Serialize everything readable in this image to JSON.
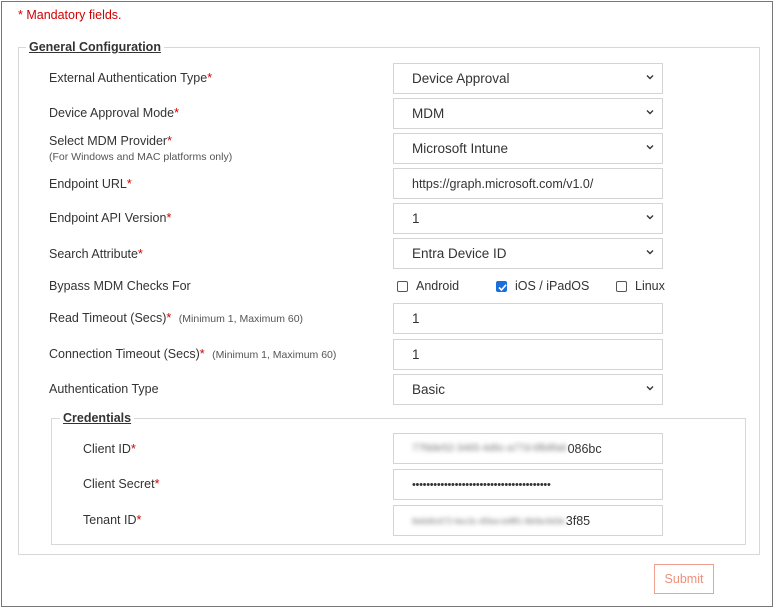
{
  "mandatory_note": "* Mandatory fields.",
  "general": {
    "legend": "General Configuration",
    "ext_auth_type": {
      "label": "External Authentication Type",
      "req": "*",
      "value": "Device Approval"
    },
    "device_approval_mode": {
      "label": "Device Approval Mode",
      "req": "*",
      "value": "MDM"
    },
    "mdm_provider": {
      "label": "Select MDM Provider",
      "req": "*",
      "hint": "(For Windows and MAC platforms only)",
      "value": "Microsoft Intune"
    },
    "endpoint_url": {
      "label": "Endpoint URL",
      "req": "*",
      "value": "https://graph.microsoft.com/v1.0/"
    },
    "endpoint_api_version": {
      "label": "Endpoint API Version",
      "req": "*",
      "value": "1"
    },
    "search_attribute": {
      "label": "Search Attribute",
      "req": "*",
      "value": "Entra Device ID"
    },
    "bypass": {
      "label": "Bypass MDM Checks For",
      "options": [
        {
          "label": "Android",
          "checked": false
        },
        {
          "label": "iOS / iPadOS",
          "checked": true
        },
        {
          "label": "Linux",
          "checked": false
        }
      ]
    },
    "read_timeout": {
      "label": "Read Timeout (Secs)",
      "req": "*",
      "hint": "(Minimum 1, Maximum 60)",
      "value": "1"
    },
    "connection_timeout": {
      "label": "Connection Timeout (Secs)",
      "req": "*",
      "hint": "(Minimum 1, Maximum 60)",
      "value": "1"
    },
    "auth_type": {
      "label": "Authentication Type",
      "value": "Basic"
    }
  },
  "credentials": {
    "legend": "Credentials",
    "client_id": {
      "label": "Client ID",
      "req": "*",
      "value_blurred": "77fdde52-3465-4d6c-a77d-6fb8fa6",
      "value_visible": "086bc"
    },
    "client_secret": {
      "label": "Client Secret",
      "req": "*",
      "value": "•••••••••••••••••••••••••••••••••••••••"
    },
    "tenant_id": {
      "label": "Tenant ID",
      "req": "*",
      "value_blurred": "8a6d0c672-6ec3c-4f3ee-b4fff1-9b0bc9d3e",
      "value_visible": "3f85"
    }
  },
  "submit_label": "Submit",
  "colors": {
    "required": "#d00000",
    "checkbox": "#1a6fd8",
    "submit": "#f0907a"
  }
}
